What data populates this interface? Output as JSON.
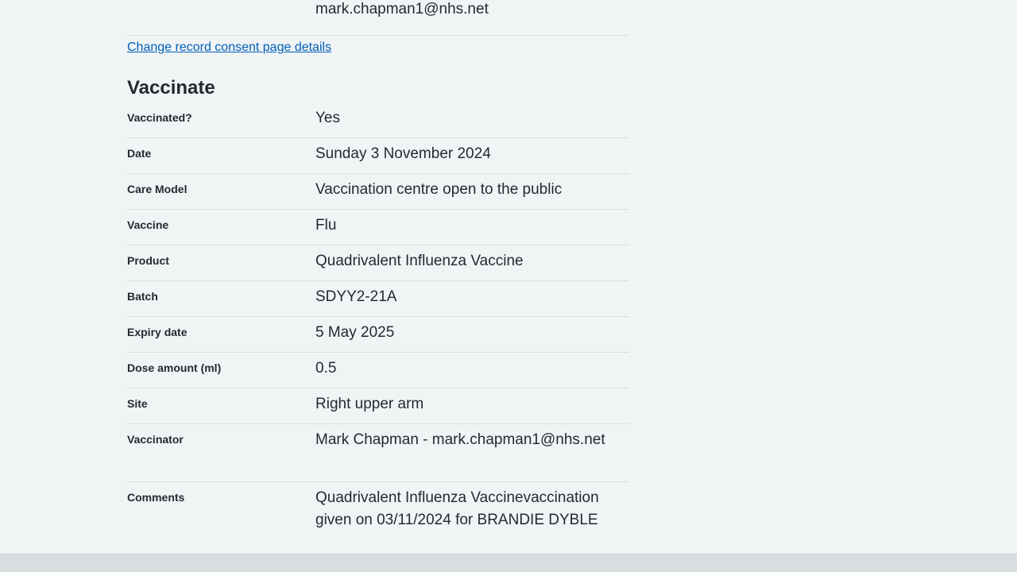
{
  "previous_section": {
    "vaccinator_value_partial": "mark.chapman1@nhs.net",
    "change_link": "Change record consent page details"
  },
  "vaccinate": {
    "heading": "Vaccinate",
    "rows": [
      {
        "key": "Vaccinated?",
        "value": "Yes"
      },
      {
        "key": "Date",
        "value": "Sunday 3 November 2024"
      },
      {
        "key": "Care Model",
        "value": "Vaccination centre open to the public"
      },
      {
        "key": "Vaccine",
        "value": "Flu"
      },
      {
        "key": "Product",
        "value": "Quadrivalent Influenza Vaccine"
      },
      {
        "key": "Batch",
        "value": "SDYY2-21A"
      },
      {
        "key": "Expiry date",
        "value": "5 May 2025"
      },
      {
        "key": "Dose amount (ml)",
        "value": "0.5"
      },
      {
        "key": "Site",
        "value": "Right upper arm"
      },
      {
        "key": "Vaccinator",
        "value": "Mark Chapman - mark.chapman1@nhs.net"
      },
      {
        "key": "Comments",
        "value": "Quadrivalent Influenza Vaccinevaccination given on 03/11/2024 for BRANDIE DYBLE"
      }
    ]
  },
  "colors": {
    "background": "#f0f4f5",
    "text": "#212b32",
    "link": "#005eb8",
    "border": "#d8dde0"
  }
}
